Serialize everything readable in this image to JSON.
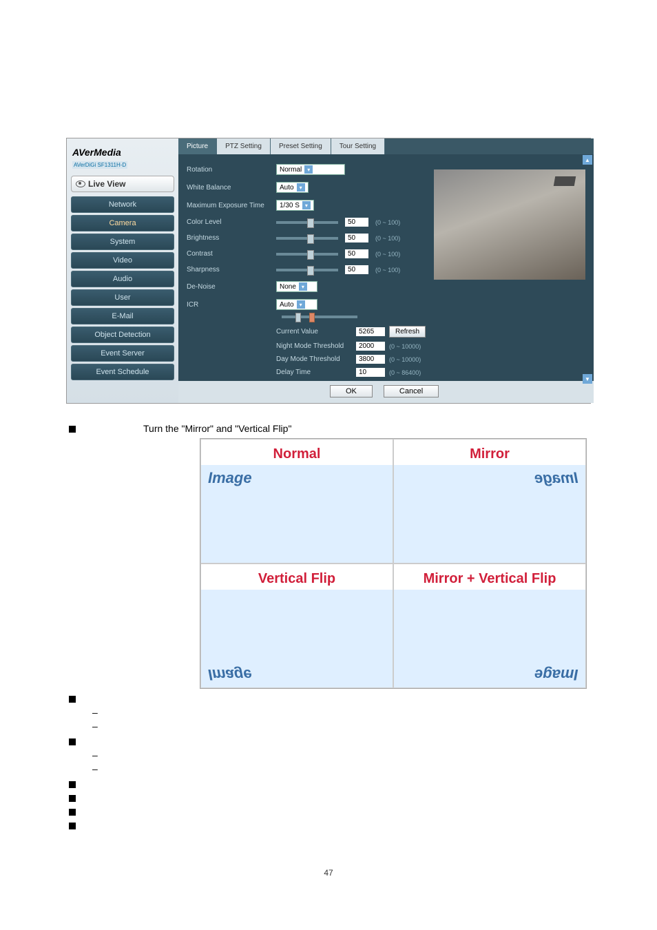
{
  "brand": {
    "main": "AVerMedia",
    "sub": "AVerDiGi SF1311H-D"
  },
  "sidebar": {
    "live_view": "Live View",
    "items": [
      {
        "label": "Network"
      },
      {
        "label": "Camera"
      },
      {
        "label": "System"
      },
      {
        "label": "Video"
      },
      {
        "label": "Audio"
      },
      {
        "label": "User"
      },
      {
        "label": "E-Mail"
      },
      {
        "label": "Object Detection"
      },
      {
        "label": "Event Server"
      },
      {
        "label": "Event Schedule"
      }
    ]
  },
  "tabs": {
    "picture": "Picture",
    "ptz": "PTZ Setting",
    "preset": "Preset Setting",
    "tour": "Tour Setting"
  },
  "settings": {
    "rotation": {
      "label": "Rotation",
      "value": "Normal"
    },
    "white_balance": {
      "label": "White Balance",
      "value": "Auto"
    },
    "max_exposure": {
      "label": "Maximum Exposure Time",
      "value": "1/30 S"
    },
    "color_level": {
      "label": "Color Level",
      "value": "50",
      "range": "(0 ~ 100)"
    },
    "brightness": {
      "label": "Brightness",
      "value": "50",
      "range": "(0 ~ 100)"
    },
    "contrast": {
      "label": "Contrast",
      "value": "50",
      "range": "(0 ~ 100)"
    },
    "sharpness": {
      "label": "Sharpness",
      "value": "50",
      "range": "(0 ~ 100)"
    },
    "denoise": {
      "label": "De-Noise",
      "value": "None"
    },
    "icr": {
      "label": "ICR",
      "value": "Auto"
    },
    "current_value": {
      "label": "Current Value",
      "value": "5265",
      "refresh": "Refresh"
    },
    "night_threshold": {
      "label": "Night Mode Threshold",
      "value": "2000",
      "range": "(0 ~ 10000)"
    },
    "day_threshold": {
      "label": "Day Mode Threshold",
      "value": "3800",
      "range": "(0 ~ 10000)"
    },
    "delay_time": {
      "label": "Delay Time",
      "value": "10",
      "range": "(0 ~ 86400)"
    }
  },
  "buttons": {
    "ok": "OK",
    "cancel": "Cancel"
  },
  "doc": {
    "rotation_line": "Turn the \"Mirror\" and \"Vertical Flip\"",
    "quad": {
      "normal_h": "Normal",
      "mirror_h": "Mirror",
      "vflip_h": "Vertical Flip",
      "mvflip_h": "Mirror + Vertical Flip",
      "sample": "Image"
    },
    "page_num": "47"
  }
}
